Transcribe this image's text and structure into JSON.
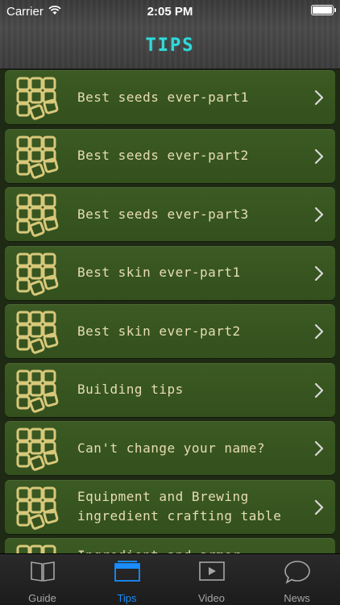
{
  "status": {
    "carrier": "Carrier",
    "time": "2:05 PM",
    "battery_level": 1.0
  },
  "header": {
    "title": "TIPS"
  },
  "list": {
    "items": [
      {
        "label": "Best seeds ever-part1"
      },
      {
        "label": "Best seeds ever-part2"
      },
      {
        "label": "Best seeds ever-part3"
      },
      {
        "label": "Best skin ever-part1"
      },
      {
        "label": "Best skin ever-part2"
      },
      {
        "label": "Building tips"
      },
      {
        "label": "Can't change your name?"
      },
      {
        "label": "Equipment and Brewing\ningredient crafting table"
      },
      {
        "label": "Ingredient and armor crafting"
      }
    ]
  },
  "tabbar": {
    "tabs": [
      {
        "label": "Guide",
        "icon": "book-icon",
        "active": false
      },
      {
        "label": "Tips",
        "icon": "window-icon",
        "active": true
      },
      {
        "label": "Video",
        "icon": "play-icon",
        "active": false
      },
      {
        "label": "News",
        "icon": "speech-bubble-icon",
        "active": false
      }
    ]
  },
  "colors": {
    "title": "#34d8d8",
    "row_bg": "#3c5a23",
    "row_text": "#e6ddb3",
    "icon_tan": "#d8c87a",
    "active_tab": "#1a8cff"
  }
}
